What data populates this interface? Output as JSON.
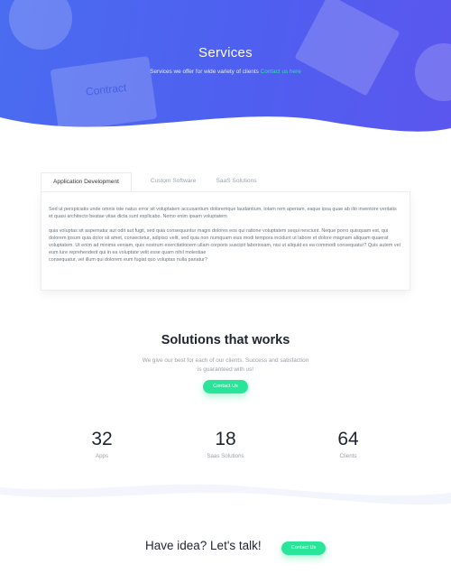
{
  "hero": {
    "title": "Services",
    "subtitle_line1": "Services we offer for wide variety of clients",
    "subtitle_link": "Contact us here",
    "bg_word": "Contract"
  },
  "tabs": [
    {
      "label": "Application Development",
      "active": true
    },
    {
      "label": "Custom Software",
      "active": false
    },
    {
      "label": "SaaS Solutions",
      "active": false
    }
  ],
  "panel": {
    "p1": "Sed ut perspiciatis unde omnis iste natus error sit voluptatem accusantium doloremque laudantium, totam rem aperiam, eaque ipsa quae ab illo inventore veritatis et quasi architecto beatae vitae dicta sunt explicabo. Nemo enim ipsam voluptatem",
    "p2": "quia voluptas sit aspernatur aut odit aut fugit, sed quia consequuntur magni dolores eos qui ratione voluptatem sequi nesciunt. Neque porro quisquam est, qui dolorem ipsum quia dolor sit amet, consectetur, adipisci velit, sed quia non numquam eius modi tempora incidunt ut labore et dolore magnam aliquam quaerat voluptatem. Ut enim ad minima veniam, quis nostrum exercitationem ullam corporis suscipit laboriosam, nisi ut aliquid ex ea commodi consequatur? Quis autem vel eum iure reprehenderit qui in ea voluptate velit esse quam nihil molestiae",
    "p3": "consequatur, vel illum qui dolorem eum fugiat quo voluptas nulla pariatur?"
  },
  "solutions": {
    "title": "Solutions that works",
    "text": "We give our best for each of our clients. Success and satisfaction is guaranteed with us!",
    "button": "Contact Us"
  },
  "stats": [
    {
      "value": "32",
      "label": "Apps"
    },
    {
      "value": "18",
      "label": "Saas Solutions"
    },
    {
      "value": "64",
      "label": "Clients"
    }
  ],
  "cta": {
    "text": "Have idea? Let's talk!",
    "button": "Contact Us"
  },
  "colors": {
    "hero": "#4f5ff0",
    "accent": "#29e59a"
  }
}
